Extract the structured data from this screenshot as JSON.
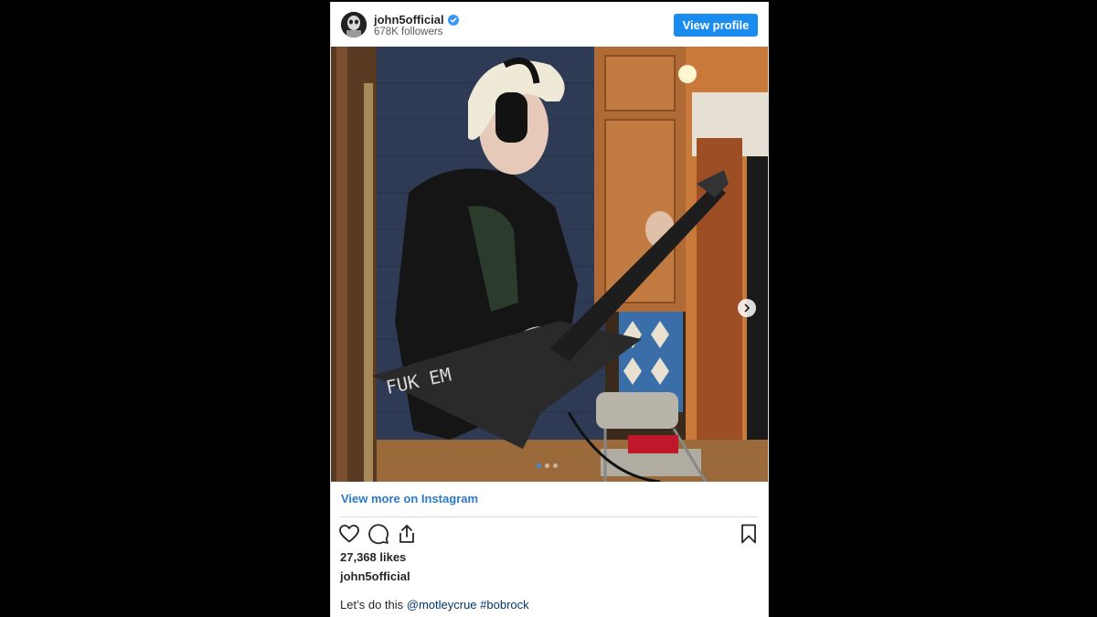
{
  "post": {
    "username": "john5official",
    "followers": "678K followers",
    "view_profile_label": "View profile",
    "view_more_label": "View more on Instagram",
    "likes": "27,368 likes",
    "caption_user": "john5official",
    "caption_prefix": "Let’s do this ",
    "mention": "@motleycrue",
    "hashtag": "#bobrock",
    "carousel": {
      "total": 3,
      "active": 1
    }
  },
  "colors": {
    "accent": "#1a8cf0",
    "link": "#2a79c9",
    "verified": "#3897f0"
  },
  "icons": {
    "verified": "verified-badge-icon",
    "like": "heart-icon",
    "comment": "comment-icon",
    "share": "share-icon",
    "save": "bookmark-icon",
    "next": "chevron-right-icon"
  }
}
